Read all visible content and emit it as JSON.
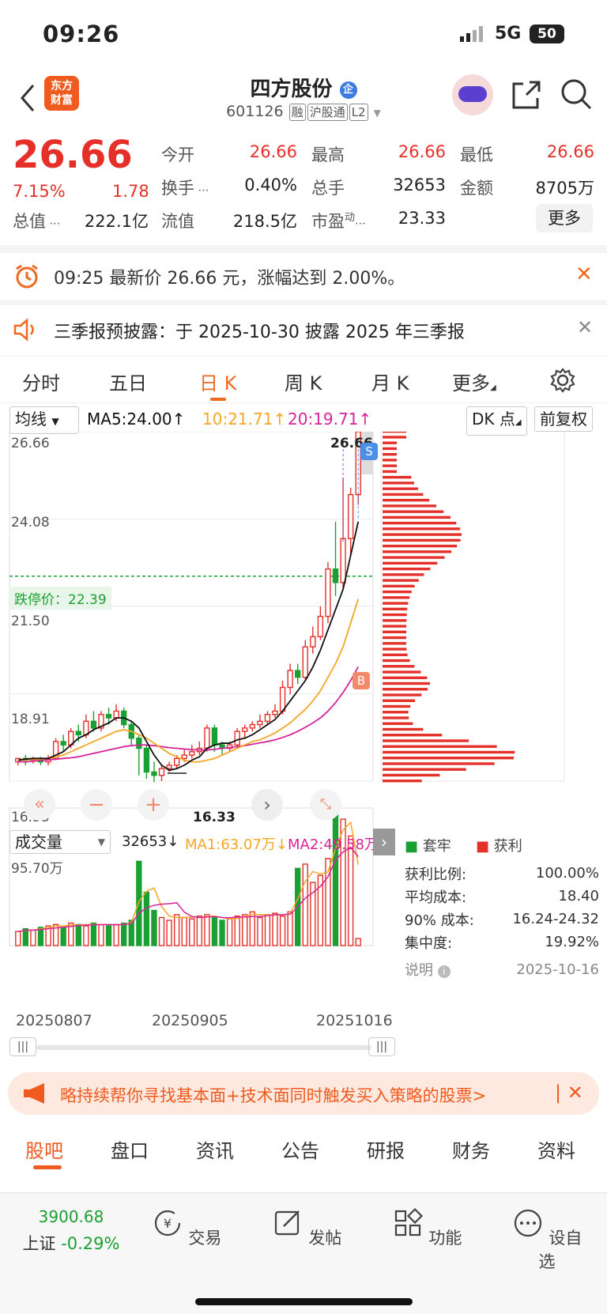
{
  "status": {
    "time": "09:26",
    "network": "5G",
    "battery": "50"
  },
  "header": {
    "stock_name": "四方股份",
    "badge": "企",
    "code": "601126",
    "tags": [
      "融",
      "沪股通",
      "L2"
    ]
  },
  "quote": {
    "price": "26.66",
    "pct": "7.15%",
    "change": "1.78",
    "rows": [
      [
        {
          "label": "今开",
          "value": "26.66",
          "color": "red"
        },
        {
          "label": "最高",
          "value": "26.66",
          "color": "red"
        },
        {
          "label": "最低",
          "value": "26.66",
          "color": "red"
        }
      ],
      [
        {
          "label": "换手",
          "value": "0.40%",
          "color": "dark"
        },
        {
          "label": "总手",
          "value": "32653",
          "color": "dark"
        },
        {
          "label": "金额",
          "value": "8705万",
          "color": "dark"
        }
      ]
    ],
    "total_value_label": "总值",
    "total_value": "222.1亿",
    "float_label": "流值",
    "float_value": "218.5亿",
    "pe_label": "市盈",
    "pe_sup": "动",
    "pe_value": "23.33",
    "more": "更多"
  },
  "alert": {
    "text": "09:25 最新价 26.66 元，涨幅达到 2.00%。"
  },
  "disclosure": {
    "text": "三季报预披露：于 2025-10-30 披露 2025 年三季报"
  },
  "period_tabs": [
    "分时",
    "五日",
    "日 K",
    "周 K",
    "月 K",
    "更多"
  ],
  "active_tab": "日 K",
  "indicators": {
    "ma_select": "均线",
    "ma5": "MA5:24.00↑",
    "ma10": "10:21.71↑",
    "ma20": "20:19.71↑",
    "dk": "DK 点",
    "adjust": "前复权"
  },
  "colors": {
    "up": "#e5302a",
    "down": "#1aa032",
    "accent": "#ef6a1f",
    "ma5": "#111111",
    "ma10": "#f5a623",
    "ma20": "#d6249a"
  },
  "chart_data": {
    "type": "candlestick",
    "y_ticks": [
      "26.66",
      "24.08",
      "21.50",
      "18.91",
      "16.33"
    ],
    "ylim": [
      16.33,
      26.66
    ],
    "limit_down_label": "跌停价：22.39",
    "limit_down": 22.39,
    "high_label": "26.66",
    "low_label": "16.33",
    "markers": [
      "S",
      "B"
    ],
    "candles": [
      [
        16.9,
        17.0,
        16.8,
        16.95
      ],
      [
        17.0,
        16.95,
        16.8,
        17.1
      ],
      [
        16.95,
        17.0,
        16.85,
        17.05
      ],
      [
        17.0,
        16.9,
        16.8,
        17.05
      ],
      [
        16.9,
        17.0,
        16.8,
        17.1
      ],
      [
        17.0,
        17.5,
        16.95,
        17.6
      ],
      [
        17.5,
        17.4,
        17.2,
        17.7
      ],
      [
        17.4,
        17.8,
        17.3,
        17.9
      ],
      [
        17.8,
        17.7,
        17.5,
        18.0
      ],
      [
        17.7,
        18.1,
        17.6,
        18.3
      ],
      [
        18.1,
        17.9,
        17.8,
        18.4
      ],
      [
        17.9,
        18.3,
        17.8,
        18.4
      ],
      [
        18.3,
        18.2,
        18.0,
        18.5
      ],
      [
        18.2,
        18.4,
        18.1,
        18.6
      ],
      [
        18.4,
        18.0,
        17.9,
        18.5
      ],
      [
        18.0,
        17.6,
        17.4,
        18.1
      ],
      [
        17.6,
        17.3,
        16.5,
        17.7
      ],
      [
        17.3,
        16.6,
        16.4,
        17.4
      ],
      [
        16.6,
        16.5,
        16.3,
        16.9
      ],
      [
        16.5,
        16.7,
        16.33,
        16.8
      ],
      [
        16.7,
        16.8,
        16.6,
        16.9
      ],
      [
        16.8,
        17.0,
        16.7,
        17.1
      ],
      [
        17.0,
        17.1,
        16.9,
        17.3
      ],
      [
        17.1,
        17.2,
        17.0,
        17.4
      ],
      [
        17.2,
        17.3,
        17.1,
        17.5
      ],
      [
        17.3,
        17.9,
        17.2,
        18.0
      ],
      [
        17.9,
        17.4,
        17.2,
        18.0
      ],
      [
        17.4,
        17.3,
        17.1,
        17.5
      ],
      [
        17.3,
        17.4,
        17.2,
        17.5
      ],
      [
        17.4,
        17.8,
        17.3,
        17.9
      ],
      [
        17.8,
        17.9,
        17.6,
        18.0
      ],
      [
        17.9,
        18.0,
        17.8,
        18.1
      ],
      [
        18.0,
        18.1,
        17.9,
        18.3
      ],
      [
        18.1,
        18.3,
        18.0,
        18.4
      ],
      [
        18.3,
        18.4,
        18.2,
        18.6
      ],
      [
        18.4,
        19.1,
        18.3,
        19.3
      ],
      [
        19.1,
        19.6,
        18.9,
        19.8
      ],
      [
        19.6,
        19.4,
        19.2,
        19.8
      ],
      [
        19.4,
        20.3,
        19.3,
        20.5
      ],
      [
        20.3,
        20.6,
        20.1,
        20.9
      ],
      [
        20.6,
        21.2,
        20.5,
        21.5
      ],
      [
        21.2,
        22.6,
        21.0,
        22.8
      ],
      [
        22.6,
        22.2,
        21.8,
        24.0
      ],
      [
        22.2,
        23.5,
        22.0,
        25.3
      ],
      [
        23.5,
        24.8,
        23.0,
        25.0
      ],
      [
        24.8,
        26.66,
        24.5,
        26.66
      ]
    ],
    "ma5": [
      16.95,
      16.98,
      17.0,
      17.0,
      17.0,
      17.1,
      17.2,
      17.4,
      17.6,
      17.7,
      17.85,
      17.95,
      18.05,
      18.2,
      18.2,
      18.1,
      17.9,
      17.5,
      17.1,
      16.8,
      16.65,
      16.7,
      16.8,
      16.95,
      17.05,
      17.3,
      17.4,
      17.45,
      17.45,
      17.55,
      17.6,
      17.7,
      17.85,
      18.0,
      18.15,
      18.4,
      18.7,
      19.0,
      19.3,
      19.7,
      20.2,
      20.8,
      21.4,
      22.0,
      23.0,
      24.0
    ],
    "ma10": [
      16.95,
      16.96,
      16.97,
      16.98,
      17.0,
      17.05,
      17.1,
      17.2,
      17.3,
      17.4,
      17.5,
      17.6,
      17.7,
      17.8,
      17.85,
      17.8,
      17.7,
      17.6,
      17.45,
      17.3,
      17.15,
      17.05,
      16.95,
      16.9,
      16.9,
      16.95,
      17.0,
      17.1,
      17.2,
      17.3,
      17.4,
      17.5,
      17.55,
      17.65,
      17.75,
      17.9,
      18.05,
      18.25,
      18.45,
      18.7,
      19.0,
      19.4,
      19.8,
      20.3,
      21.0,
      21.71
    ],
    "ma20": [
      16.9,
      16.9,
      16.92,
      16.94,
      16.96,
      16.98,
      17.0,
      17.02,
      17.05,
      17.1,
      17.15,
      17.2,
      17.25,
      17.3,
      17.35,
      17.38,
      17.4,
      17.4,
      17.38,
      17.35,
      17.32,
      17.3,
      17.28,
      17.26,
      17.25,
      17.25,
      17.27,
      17.3,
      17.32,
      17.35,
      17.38,
      17.42,
      17.46,
      17.5,
      17.55,
      17.62,
      17.7,
      17.8,
      17.92,
      18.05,
      18.2,
      18.4,
      18.65,
      18.95,
      19.3,
      19.71
    ],
    "volume_label": "成交量",
    "volume_value": "32653↓",
    "vma1": "MA1:63.07万↓",
    "vma2": "MA2:49.58万",
    "volume_max": "95.70万",
    "volumes": [
      10,
      12,
      11,
      13,
      14,
      15,
      13,
      16,
      15,
      14,
      16,
      15,
      14,
      15,
      16,
      18,
      60,
      38,
      25,
      20,
      18,
      22,
      20,
      19,
      21,
      22,
      20,
      18,
      19,
      21,
      22,
      24,
      20,
      22,
      23,
      21,
      24,
      55,
      58,
      45,
      50,
      62,
      95,
      90,
      78,
      5
    ],
    "dates": [
      "20250807",
      "20250905",
      "20251016"
    ],
    "chip_stats": [
      {
        "label": "获利比例:",
        "value": "100.00%"
      },
      {
        "label": "平均成本:",
        "value": "18.40"
      },
      {
        "label": "90% 成本:",
        "value": "16.24-24.32"
      },
      {
        "label": "集中度:",
        "value": "19.92%"
      }
    ],
    "chip_legend": [
      "套牢",
      "获利"
    ],
    "chip_note": "说明",
    "chip_date": "2025-10-16"
  },
  "strategy_banner": "略持续帮你寻找基本面+技术面同时触发买入策略的股票>",
  "sub_tabs": [
    "股吧",
    "盘口",
    "资讯",
    "公告",
    "研报",
    "财务",
    "资料"
  ],
  "active_sub_tab": "股吧",
  "bottom_bar": {
    "index_value": "3900.68",
    "index_name": "上证",
    "index_pct": "-0.29%",
    "items": [
      "交易",
      "发帖",
      "功能",
      "设自选"
    ]
  }
}
